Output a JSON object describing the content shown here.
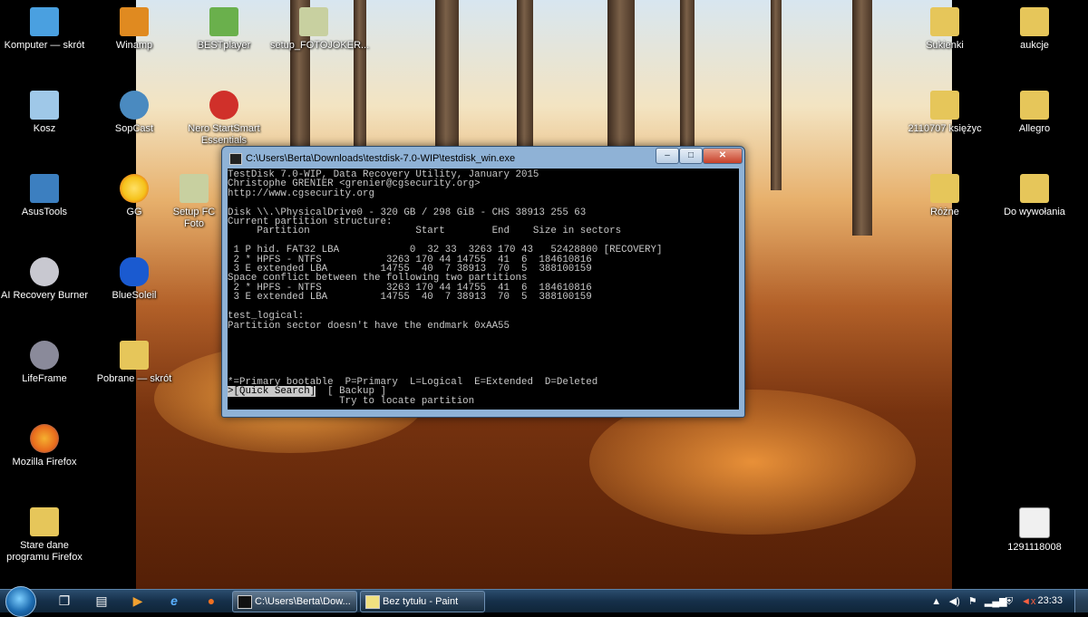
{
  "desktop": {
    "icons": [
      {
        "label": "Komputer — skrót",
        "icon": "computer-icon",
        "color": "#4aa0e0"
      },
      {
        "label": "Kosz",
        "icon": "recycle-bin-icon",
        "color": "#9fc8e8"
      },
      {
        "label": "AsusTools",
        "icon": "asus-tools-icon",
        "color": "#3c7fc0"
      },
      {
        "label": "AI Recovery Burner",
        "icon": "disc-icon",
        "color": "#c8c8d0"
      },
      {
        "label": "LifeFrame",
        "icon": "webcam-icon",
        "color": "#8a8a9a"
      },
      {
        "label": "Mozilla Firefox",
        "icon": "firefox-icon",
        "color": "#e86a1c"
      },
      {
        "label": "Stare dane programu Firefox",
        "icon": "folder-icon",
        "color": "#e6c65a"
      },
      {
        "label": "Winamp",
        "icon": "winamp-icon",
        "color": "#e08a20"
      },
      {
        "label": "SopCast",
        "icon": "sopcast-icon",
        "color": "#4a8ac0"
      },
      {
        "label": "GG",
        "icon": "gg-sun-icon",
        "color": "#f5c21a"
      },
      {
        "label": "BlueSoleil",
        "icon": "bluetooth-icon",
        "color": "#1a5ad0"
      },
      {
        "label": "Pobrane — skrót",
        "icon": "folder-icon",
        "color": "#e6c65a"
      },
      {
        "label": "BESTplayer",
        "icon": "film-icon",
        "color": "#6ab04c"
      },
      {
        "label": "Nero StartSmart Essentials",
        "icon": "nero-icon",
        "color": "#d0302a"
      },
      {
        "label": "setup_FOTOJOKER...",
        "icon": "installer-icon",
        "color": "#c8d0a0"
      },
      {
        "label": "Setup FC Foto",
        "icon": "installer-icon",
        "color": "#c8d0a0"
      },
      {
        "label": "Sukienki",
        "icon": "folder-icon",
        "color": "#e6c65a"
      },
      {
        "label": "2110707 księżyc",
        "icon": "folder-icon",
        "color": "#e6c65a"
      },
      {
        "label": "Różne",
        "icon": "folder-icon",
        "color": "#e6c65a"
      },
      {
        "label": "aukcje",
        "icon": "folder-icon",
        "color": "#e6c65a"
      },
      {
        "label": "Allegro",
        "icon": "folder-icon",
        "color": "#e6c65a"
      },
      {
        "label": "Do wywołania",
        "icon": "folder-icon",
        "color": "#e6c65a"
      },
      {
        "label": "1291118008",
        "icon": "image-file-icon",
        "color": "#f0f0f0"
      }
    ]
  },
  "console_window": {
    "title": "C:\\Users\\Berta\\Downloads\\testdisk-7.0-WIP\\testdisk_win.exe",
    "minimize_label": "–",
    "maximize_label": "□",
    "close_label": "✕",
    "lines": [
      "TestDisk 7.0-WIP, Data Recovery Utility, January 2015",
      "Christophe GRENIER <grenier@cgsecurity.org>",
      "http://www.cgsecurity.org",
      "",
      "Disk \\\\.\\PhysicalDrive0 - 320 GB / 298 GiB - CHS 38913 255 63",
      "Current partition structure:",
      "     Partition                  Start        End    Size in sectors",
      "",
      " 1 P hid. FAT32 LBA            0  32 33  3263 170 43   52428800 [RECOVERY]",
      " 2 * HPFS - NTFS           3263 170 44 14755  41  6  184610816",
      " 3 E extended LBA         14755  40  7 38913  70  5  388100159",
      "Space conflict between the following two partitions",
      " 2 * HPFS - NTFS           3263 170 44 14755  41  6  184610816",
      " 3 E extended LBA         14755  40  7 38913  70  5  388100159",
      "",
      "test_logical:",
      "Partition sector doesn't have the endmark 0xAA55",
      "",
      "",
      "",
      "",
      "",
      "*=Primary bootable  P=Primary  L=Logical  E=Extended  D=Deleted"
    ],
    "menu_selected": ">[Quick Search]",
    "menu_other": "  [ Backup ]",
    "hint": "                   Try to locate partition"
  },
  "taskbar": {
    "pinned": [
      {
        "name": "explorer-pin",
        "glyph": "❐"
      },
      {
        "name": "folder-pin",
        "glyph": "▤"
      },
      {
        "name": "media-player-pin",
        "glyph": "▶"
      },
      {
        "name": "ie-pin",
        "glyph": "e"
      },
      {
        "name": "firefox-pin",
        "glyph": "●"
      }
    ],
    "tasks": [
      {
        "label": "C:\\Users\\Berta\\Dow...",
        "icon": "console-icon"
      },
      {
        "label": "Bez tytułu - Paint",
        "icon": "paint-icon"
      }
    ],
    "tray_icons": [
      "▲",
      "◀)",
      "⚑",
      "▂▄▆",
      "⛨",
      "◄x"
    ],
    "clock": "23:33"
  }
}
